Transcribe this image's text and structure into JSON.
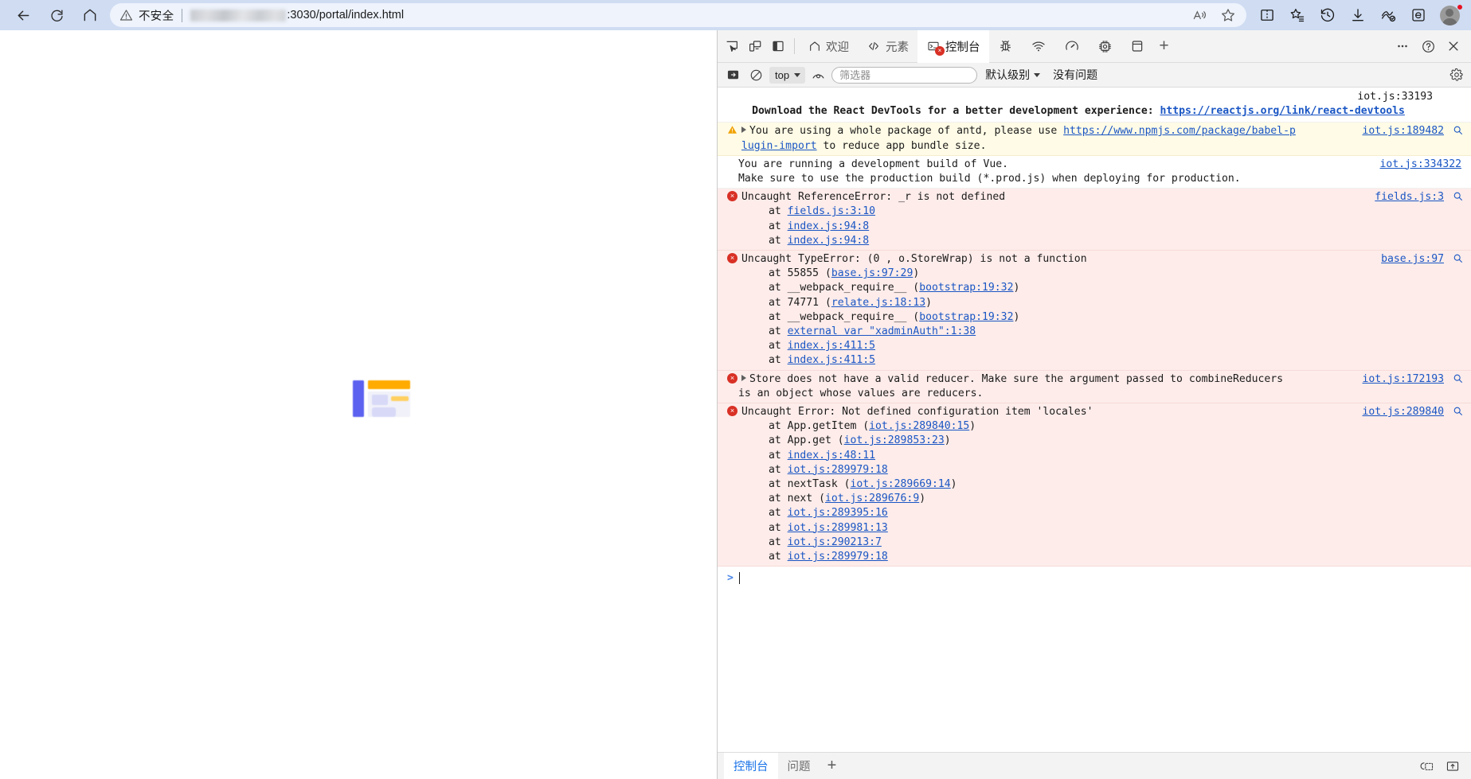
{
  "browser": {
    "nav": {
      "back_icon": "arrow-left-icon",
      "reload_icon": "reload-icon",
      "home_icon": "home-icon"
    },
    "address": {
      "security_label": "不安全",
      "security_icon": "warning-triangle-icon",
      "url_redacted": true,
      "url_visible": ":3030/portal/index.html",
      "read_aloud_icon": "read-aloud-icon",
      "favorite_icon": "star-icon"
    },
    "toolbar_icons": [
      {
        "name": "split-screen-icon"
      },
      {
        "name": "collections-icon"
      },
      {
        "name": "history-icon"
      },
      {
        "name": "downloads-icon"
      },
      {
        "name": "browser-essentials-icon"
      },
      {
        "name": "ie-mode-icon"
      }
    ],
    "profile": {
      "name": "profile-avatar",
      "badge": true
    }
  },
  "page": {
    "loading_art": {
      "name": "loading-placeholder-graphic",
      "colors": {
        "bar": "#5c61f0",
        "accent": "#ffab00",
        "block": "#d7d9f7",
        "block_light": "#eceef9",
        "accent_light": "#ffd061"
      }
    }
  },
  "devtools": {
    "tools": [
      {
        "name": "inspect-element-icon"
      },
      {
        "name": "device-toolbar-icon"
      },
      {
        "name": "dock-side-icon"
      }
    ],
    "tabs": [
      {
        "label": "欢迎",
        "icon": "home-icon",
        "active": false
      },
      {
        "label": "元素",
        "icon": "code-brackets-icon",
        "active": false
      },
      {
        "label": "控制台",
        "icon": "console-terminal-icon",
        "active": true,
        "error_badge": true
      }
    ],
    "tab_icons": [
      {
        "name": "bug-icon"
      },
      {
        "name": "network-wifi-icon"
      },
      {
        "name": "performance-gauge-icon"
      },
      {
        "name": "memory-chip-icon"
      },
      {
        "name": "application-storage-icon"
      }
    ],
    "add_tab_label": "+",
    "header_right": [
      {
        "name": "more-options-icon",
        "label": "…"
      },
      {
        "name": "help-icon",
        "label": "?"
      },
      {
        "name": "close-devtools-icon",
        "label": "✕"
      }
    ],
    "filterbar": {
      "sidebar_toggle_icon": "console-sidebar-icon",
      "clear_console_icon": "clear-console-icon",
      "context_value": "top",
      "live_expression_icon": "eye-icon",
      "filter_placeholder": "筛选器",
      "filter_value": "",
      "level_label": "默认级别",
      "issues_label": "没有问题",
      "settings_icon": "gear-icon"
    },
    "messages": [
      {
        "type": "info",
        "source": "iot.js:33193",
        "text_prefix": "Download the React DevTools for a better development experience: ",
        "link": "https://reactjs.org/link/react-devtools"
      },
      {
        "type": "warn",
        "source": "iot.js:189482",
        "line1a": "You are using a whole package of antd, please use ",
        "link": "https://www.npmjs.com/package/babel-plugin-import",
        "link_part1": "https://www.npmjs.com/package/babel-p",
        "link_part2": "lugin-import",
        "line2b": " to reduce app bundle size."
      },
      {
        "type": "info",
        "source": "iot.js:334322",
        "line1": "You are running a development build of Vue.",
        "line2": "Make sure to use the production build (*.prod.js) when deploying for production."
      },
      {
        "type": "error",
        "source": "fields.js:3",
        "title": "Uncaught ReferenceError: _r is not defined",
        "stack": [
          "fields.js:3:10",
          "index.js:94:8",
          "index.js:94:8"
        ]
      },
      {
        "type": "error",
        "source": "base.js:97",
        "title": "Uncaught TypeError: (0 , o.StoreWrap) is not a function",
        "stack_rich": [
          {
            "pre": "at 55855 (",
            "link": "base.js:97:29",
            "post": ")"
          },
          {
            "pre": "at __webpack_require__ (",
            "link": "bootstrap:19:32",
            "post": ")"
          },
          {
            "pre": "at 74771 (",
            "link": "relate.js:18:13",
            "post": ")"
          },
          {
            "pre": "at __webpack_require__ (",
            "link": "bootstrap:19:32",
            "post": ")"
          },
          {
            "pre": "at ",
            "link": "external var \"xadminAuth\":1:38",
            "post": ""
          },
          {
            "pre": "at ",
            "link": "index.js:411:5",
            "post": ""
          },
          {
            "pre": "at ",
            "link": "index.js:411:5",
            "post": ""
          }
        ]
      },
      {
        "type": "error",
        "source": "iot.js:172193",
        "expandable": true,
        "line1": "Store does not have a valid reducer. Make sure the argument passed to combineReducers",
        "line2": "is an object whose values are reducers."
      },
      {
        "type": "error",
        "source": "iot.js:289840",
        "title": "Uncaught Error: Not defined configuration item 'locales'",
        "stack_rich": [
          {
            "pre": "at App.getItem (",
            "link": "iot.js:289840:15",
            "post": ")"
          },
          {
            "pre": "at App.get (",
            "link": "iot.js:289853:23",
            "post": ")"
          },
          {
            "pre": "at ",
            "link": "index.js:48:11",
            "post": ""
          },
          {
            "pre": "at ",
            "link": "iot.js:289979:18",
            "post": ""
          },
          {
            "pre": "at nextTask (",
            "link": "iot.js:289669:14",
            "post": ")"
          },
          {
            "pre": "at next (",
            "link": "iot.js:289676:9",
            "post": ")"
          },
          {
            "pre": "at ",
            "link": "iot.js:289395:16",
            "post": ""
          },
          {
            "pre": "at ",
            "link": "iot.js:289981:13",
            "post": ""
          },
          {
            "pre": "at ",
            "link": "iot.js:290213:7",
            "post": ""
          },
          {
            "pre": "at ",
            "link": "iot.js:289979:18",
            "post": ""
          }
        ]
      }
    ],
    "prompt": {
      "arrow": ">",
      "value": ""
    },
    "drawer": {
      "tabs": [
        {
          "label": "控制台",
          "active": true
        },
        {
          "label": "问题",
          "active": false
        }
      ],
      "add_label": "+",
      "right_icons": [
        {
          "name": "restore-drawer-icon"
        },
        {
          "name": "dock-bottom-icon"
        }
      ]
    }
  },
  "colors": {
    "chrome_bg": "#cfdcf2",
    "error_bg": "#fdecea",
    "warn_bg": "#fffbe6",
    "link": "#1a56c4",
    "error_red": "#d93025",
    "accent_blue": "#1a73e8"
  }
}
